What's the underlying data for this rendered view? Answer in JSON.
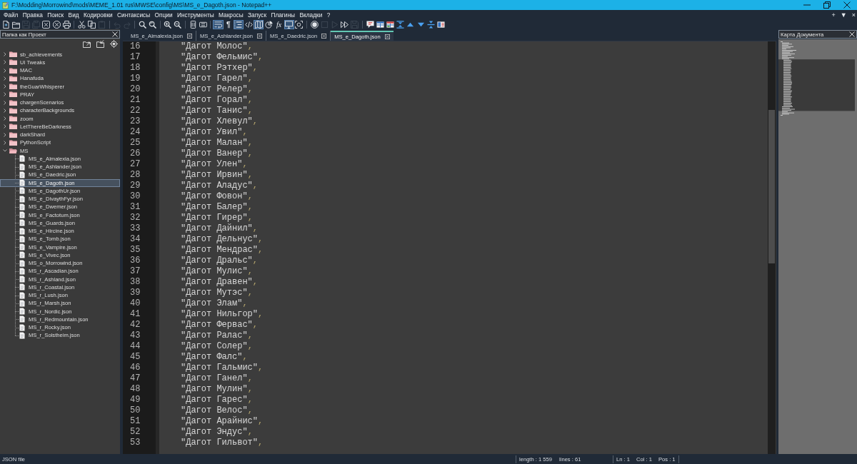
{
  "window": {
    "title": "F:\\Modding\\Morrowind\\mods\\MEME_1.01 rus\\MWSE\\config\\MS\\MS_e_Dagoth.json - Notepad++"
  },
  "menu": {
    "items": [
      "Файл",
      "Правка",
      "Поиск",
      "Вид",
      "Кодировки",
      "Синтаксисы",
      "Опции",
      "Инструменты",
      "Макросы",
      "Запуск",
      "Плагины",
      "Вкладки",
      "?"
    ],
    "controls": [
      "+",
      "▼",
      "×"
    ]
  },
  "toolbar": [
    {
      "buttons": [
        {
          "on": false,
          "disabled": false
        },
        {
          "on": false,
          "disabled": false
        },
        {
          "on": false,
          "disabled": true
        },
        {
          "on": false,
          "disabled": true
        },
        {
          "on": false,
          "disabled": false
        },
        {
          "on": false,
          "disabled": false
        },
        {
          "on": false,
          "disabled": false
        }
      ]
    },
    {
      "buttons": [
        {
          "on": false,
          "disabled": false
        },
        {
          "on": false,
          "disabled": false
        },
        {
          "on": false,
          "disabled": true
        }
      ]
    },
    {
      "buttons": [
        {
          "on": false,
          "disabled": true
        },
        {
          "on": false,
          "disabled": true
        }
      ]
    },
    {
      "buttons": [
        {
          "on": false,
          "disabled": false
        },
        {
          "on": false,
          "disabled": false
        }
      ]
    },
    {
      "buttons": [
        {
          "on": false,
          "disabled": false
        },
        {
          "on": false,
          "disabled": false
        }
      ]
    },
    {
      "buttons": [
        {
          "on": false,
          "disabled": false
        },
        {
          "on": false,
          "disabled": false
        }
      ]
    },
    {
      "buttons": [
        {
          "on": true,
          "disabled": false
        },
        {
          "glyph": "¶",
          "on": false,
          "disabled": false
        },
        {
          "on": true,
          "disabled": false
        },
        {
          "on": false,
          "disabled": false
        },
        {
          "on": true,
          "disabled": false
        },
        {
          "on": false,
          "disabled": false
        },
        {
          "glyph": "fx",
          "on": false,
          "disabled": false
        },
        {
          "on": true,
          "disabled": false
        },
        {
          "on": false,
          "disabled": false
        }
      ]
    },
    {
      "buttons": [
        {
          "on": false,
          "disabled": false
        },
        {
          "on": false,
          "disabled": true
        },
        {
          "on": false,
          "disabled": true
        },
        {
          "on": false,
          "disabled": false
        },
        {
          "on": false,
          "disabled": true
        }
      ]
    },
    {
      "buttons": [
        {
          "on": false,
          "disabled": false
        },
        {
          "on": false,
          "disabled": false
        },
        {
          "on": false,
          "disabled": false
        },
        {
          "on": false,
          "disabled": false
        },
        {
          "on": false,
          "disabled": false
        },
        {
          "on": false,
          "disabled": false
        },
        {
          "on": false,
          "disabled": false
        },
        {
          "on": false,
          "disabled": false
        }
      ]
    }
  ],
  "project_panel": {
    "title": "Папка как Проект",
    "items": [
      {
        "kind": "folder",
        "label": "sb_achievements",
        "expanded": false,
        "selected": false
      },
      {
        "kind": "folder",
        "label": "UI Tweaks",
        "expanded": false,
        "selected": false
      },
      {
        "kind": "folder",
        "label": "MAC",
        "expanded": false,
        "selected": false
      },
      {
        "kind": "folder",
        "label": "Hanafuda",
        "expanded": false,
        "selected": false
      },
      {
        "kind": "folder",
        "label": "theGuarWhisperer",
        "expanded": false,
        "selected": false
      },
      {
        "kind": "folder",
        "label": "PRAY",
        "expanded": false,
        "selected": false
      },
      {
        "kind": "folder",
        "label": "chargenScenarios",
        "expanded": false,
        "selected": false
      },
      {
        "kind": "folder",
        "label": "characterBackgrounds",
        "expanded": false,
        "selected": false
      },
      {
        "kind": "folder",
        "label": "zoom",
        "expanded": false,
        "selected": false
      },
      {
        "kind": "folder",
        "label": "LetThereBeDarkness",
        "expanded": false,
        "selected": false
      },
      {
        "kind": "folder",
        "label": "darkShard",
        "expanded": false,
        "selected": false
      },
      {
        "kind": "folder",
        "label": "PythonScript",
        "expanded": false,
        "selected": false
      },
      {
        "kind": "folder",
        "label": "MS",
        "expanded": true,
        "selected": false,
        "children": [
          {
            "kind": "file",
            "label": "MS_e_Almalexia.json",
            "selected": false
          },
          {
            "kind": "file",
            "label": "MS_e_Ashlander.json",
            "selected": false
          },
          {
            "kind": "file",
            "label": "MS_e_Daedric.json",
            "selected": false
          },
          {
            "kind": "file",
            "label": "MS_e_Dagoth.json",
            "selected": true
          },
          {
            "kind": "file",
            "label": "MS_e_DagothUr.json",
            "selected": false
          },
          {
            "kind": "file",
            "label": "MS_e_DivaythFyr.json",
            "selected": false
          },
          {
            "kind": "file",
            "label": "MS_e_Dwemer.json",
            "selected": false
          },
          {
            "kind": "file",
            "label": "MS_e_Factotum.json",
            "selected": false
          },
          {
            "kind": "file",
            "label": "MS_e_Guards.json",
            "selected": false
          },
          {
            "kind": "file",
            "label": "MS_e_Hircine.json",
            "selected": false
          },
          {
            "kind": "file",
            "label": "MS_e_Tomb.json",
            "selected": false
          },
          {
            "kind": "file",
            "label": "MS_e_Vampire.json",
            "selected": false
          },
          {
            "kind": "file",
            "label": "MS_e_Vivec.json",
            "selected": false
          },
          {
            "kind": "file",
            "label": "MS_o_Morrowind.json",
            "selected": false
          },
          {
            "kind": "file",
            "label": "MS_r_Ascadian.json",
            "selected": false
          },
          {
            "kind": "file",
            "label": "MS_r_Ashland.json",
            "selected": false
          },
          {
            "kind": "file",
            "label": "MS_r_Coastal.json",
            "selected": false
          },
          {
            "kind": "file",
            "label": "MS_r_Lush.json",
            "selected": false
          },
          {
            "kind": "file",
            "label": "MS_r_Marsh.json",
            "selected": false
          },
          {
            "kind": "file",
            "label": "MS_r_Nordic.json",
            "selected": false
          },
          {
            "kind": "file",
            "label": "MS_r_Redmountain.json",
            "selected": false
          },
          {
            "kind": "file",
            "label": "MS_r_Rocky.json",
            "selected": false
          },
          {
            "kind": "file",
            "label": "MS_r_Solstheim.json",
            "selected": false
          }
        ]
      }
    ]
  },
  "editor": {
    "tabs": [
      {
        "label": "MS_e_Almalexia.json",
        "selected": false
      },
      {
        "label": "MS_e_Ashlander.json",
        "selected": false
      },
      {
        "label": "MS_e_Daedric.json",
        "selected": false
      },
      {
        "label": "MS_e_Dagoth.json",
        "selected": true
      }
    ],
    "lines": [
      {
        "number": "16",
        "string": "\"Дагот Молос\"",
        "punct": ","
      },
      {
        "number": "17",
        "string": "\"Дагот Фельмис\"",
        "punct": ","
      },
      {
        "number": "18",
        "string": "\"Дагот Рэтхер\"",
        "punct": ","
      },
      {
        "number": "19",
        "string": "\"Дагот Гарел\"",
        "punct": ","
      },
      {
        "number": "20",
        "string": "\"Дагот Релер\"",
        "punct": ","
      },
      {
        "number": "21",
        "string": "\"Дагот Горал\"",
        "punct": ","
      },
      {
        "number": "22",
        "string": "\"Дагот Танис\"",
        "punct": ","
      },
      {
        "number": "23",
        "string": "\"Дагот Хлевул\"",
        "punct": ","
      },
      {
        "number": "24",
        "string": "\"Дагот Увил\"",
        "punct": ","
      },
      {
        "number": "25",
        "string": "\"Дагот Малан\"",
        "punct": ","
      },
      {
        "number": "26",
        "string": "\"Дагот Ванер\"",
        "punct": ","
      },
      {
        "number": "27",
        "string": "\"Дагот Улен\"",
        "punct": ","
      },
      {
        "number": "28",
        "string": "\"Дагот Ирвин\"",
        "punct": ","
      },
      {
        "number": "29",
        "string": "\"Дагот Аладус\"",
        "punct": ","
      },
      {
        "number": "30",
        "string": "\"Дагот Фовон\"",
        "punct": ","
      },
      {
        "number": "31",
        "string": "\"Дагот Балер\"",
        "punct": ","
      },
      {
        "number": "32",
        "string": "\"Дагот Гирер\"",
        "punct": ","
      },
      {
        "number": "33",
        "string": "\"Дагот Дайнил\"",
        "punct": ","
      },
      {
        "number": "34",
        "string": "\"Дагот Дельнус\"",
        "punct": ","
      },
      {
        "number": "35",
        "string": "\"Дагот Мендрас\"",
        "punct": ","
      },
      {
        "number": "36",
        "string": "\"Дагот Дральс\"",
        "punct": ","
      },
      {
        "number": "37",
        "string": "\"Дагот Мулис\"",
        "punct": ","
      },
      {
        "number": "38",
        "string": "\"Дагот Дравен\"",
        "punct": ","
      },
      {
        "number": "39",
        "string": "\"Дагот Мутэс\"",
        "punct": ","
      },
      {
        "number": "40",
        "string": "\"Дагот Элам\"",
        "punct": ","
      },
      {
        "number": "41",
        "string": "\"Дагот Нильгор\"",
        "punct": ","
      },
      {
        "number": "42",
        "string": "\"Дагот Фервас\"",
        "punct": ","
      },
      {
        "number": "43",
        "string": "\"Дагот Ралас\"",
        "punct": ","
      },
      {
        "number": "44",
        "string": "\"Дагот Солер\"",
        "punct": ","
      },
      {
        "number": "45",
        "string": "\"Дагот Фалс\"",
        "punct": ","
      },
      {
        "number": "46",
        "string": "\"Дагот Гальмис\"",
        "punct": ","
      },
      {
        "number": "47",
        "string": "\"Дагот Ганел\"",
        "punct": ","
      },
      {
        "number": "48",
        "string": "\"Дагот Мулин\"",
        "punct": ","
      },
      {
        "number": "49",
        "string": "\"Дагот Гарес\"",
        "punct": ","
      },
      {
        "number": "50",
        "string": "\"Дагот Велос\"",
        "punct": ","
      },
      {
        "number": "51",
        "string": "\"Дагот Арайнис\"",
        "punct": ","
      },
      {
        "number": "52",
        "string": "\"Дагот Эндус\"",
        "punct": ","
      },
      {
        "number": "53",
        "string": "\"Дагот Гильвот\"",
        "punct": ","
      }
    ]
  },
  "document_map": {
    "title": "Карта Документа"
  },
  "status_bar": {
    "file_type": "JSON file",
    "length": "length : 1 559",
    "lines": "lines : 61",
    "ln": "Ln : 1",
    "col": "Col : 1",
    "pos": "Pos : 1"
  }
}
